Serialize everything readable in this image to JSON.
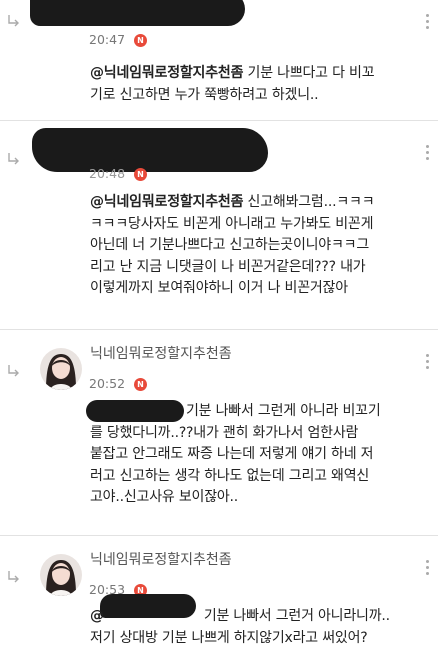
{
  "replies": [
    {
      "nickname": "",
      "time": "20:47",
      "badge": "N",
      "lines": [
        {
          "mention": "@닉네임뭐로정할지추천좀",
          "text": " 기분 나쁘다고 다 비꼬"
        },
        {
          "mention": "",
          "text": "기로 신고하면 누가 쭉빵하려고 하겠니.."
        }
      ]
    },
    {
      "nickname": "",
      "time": "20:48",
      "badge": "N",
      "lines": [
        {
          "mention": "@닉네임뭐로정할지추천좀",
          "text": " 신고해봐그럼...ㅋㅋㅋ"
        },
        {
          "mention": "",
          "text": "ㅋㅋㅋ당사자도 비꼰게 아니래고 누가봐도 비꼰게"
        },
        {
          "mention": "",
          "text": "아닌데 너 기분나쁘다고 신고하는곳이니야ㅋㅋ그"
        },
        {
          "mention": "",
          "text": "리고 난 지금 니댓글이 나 비꼰거같은데??? 내가"
        },
        {
          "mention": "",
          "text": "이렇게까지 보여줘야하니 이거 나 비꼰거잖아"
        }
      ]
    },
    {
      "nickname": "닉네임뭐로정할지추천좀",
      "time": "20:52",
      "badge": "N",
      "lines": [
        {
          "mention": "",
          "text": "기분 나빠서 그런게 아니라 비꼬기"
        },
        {
          "mention": "",
          "text": "를 당했다니까..??내가 괜히 화가나서 엄한사람"
        },
        {
          "mention": "",
          "text": "붙잡고 안그래도 짜증 나는데 저렇게 얘기 하네 저"
        },
        {
          "mention": "",
          "text": "러고 신고하는 생각 하나도 없는데 그리고 왜역신"
        },
        {
          "mention": "",
          "text": "고야..신고사유 보이잖아.."
        }
      ]
    },
    {
      "nickname": "닉네임뭐로정할지추천좀",
      "time": "20:53",
      "badge": "N",
      "lines": [
        {
          "mention": "@",
          "text": "기분 나빠서 그런거 아니라니까.."
        },
        {
          "mention": "",
          "text": "저기 상대방 기분 나쁘게 하지않기x라고 써있어?"
        }
      ]
    }
  ],
  "colors": {
    "background": "#f3f3f3",
    "card": "#ffffff",
    "badge": "#e84a3a",
    "redaction": "#1a1a1a"
  },
  "icons": {
    "reply_arrow": "reply-arrow-icon",
    "badge": "new-badge-icon",
    "menu": "kebab-menu-icon"
  }
}
